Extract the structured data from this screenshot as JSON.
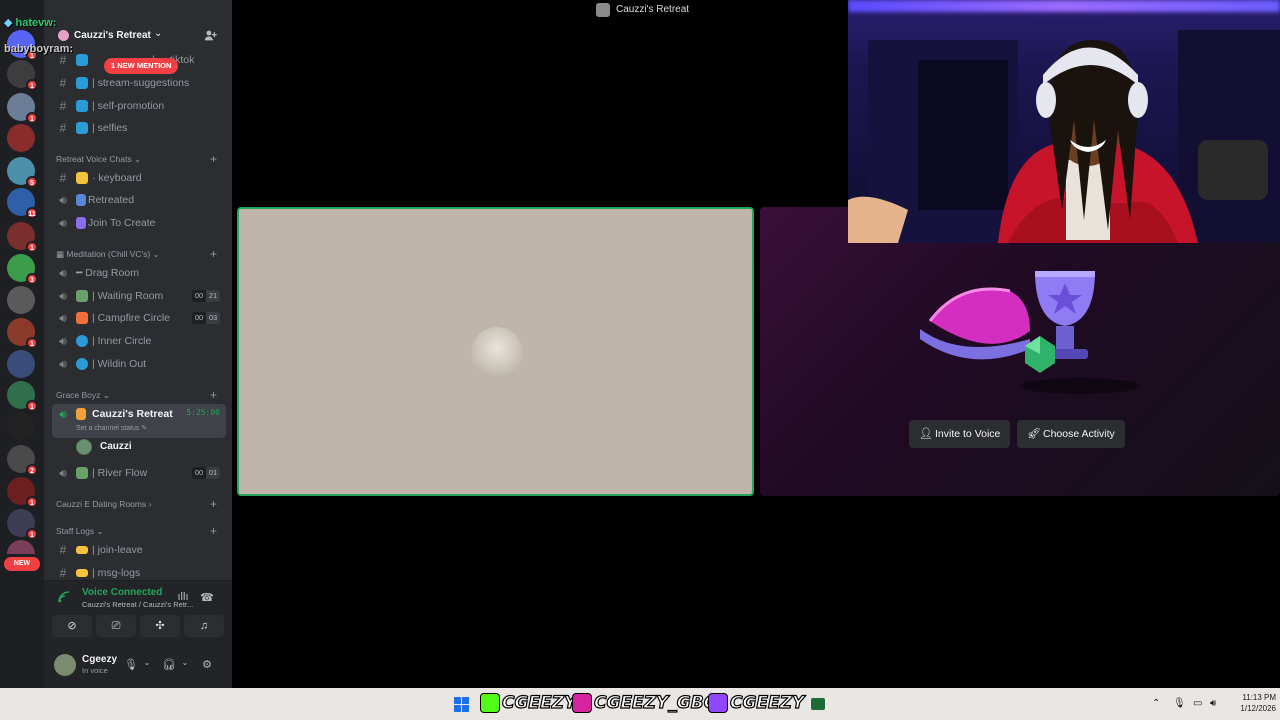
{
  "window": {
    "title": "Cauzzi's Retreat"
  },
  "stream_chat": [
    {
      "user": "hatevw:"
    },
    {
      "user": "babyboyram:"
    }
  ],
  "server": {
    "name": "Cauzzi's Retreat",
    "mention_pill": "1 NEW MENTION"
  },
  "rail": {
    "new_label": "NEW",
    "badges": [
      "1",
      "1",
      "1",
      "5",
      "11",
      "1",
      "3",
      "1",
      "1",
      "2",
      "1",
      "1",
      "1",
      "1",
      "1"
    ]
  },
  "channels_top": [
    {
      "label": "| ...-tiktok"
    },
    {
      "label": "| stream-suggestions"
    },
    {
      "label": "| self-promotion"
    },
    {
      "label": "| selfies"
    }
  ],
  "categories": {
    "retreat_voice": "Retreat Voice Chats",
    "meditation": "Meditation (Chill VC's)",
    "grace_boyz": "Grace Boyz",
    "dating": "Cauzzi E Dating Rooms",
    "staff_logs": "Staff Logs"
  },
  "retreat_voice_channels": [
    {
      "label": "· keyboard"
    },
    {
      "label": "Retreated"
    },
    {
      "label": "Join To Create"
    }
  ],
  "meditation_channels": [
    {
      "label": "Drag Room"
    },
    {
      "label": "| Waiting Room",
      "count_a": "00",
      "count_b": "21"
    },
    {
      "label": "| Campfire Circle",
      "count_a": "00",
      "count_b": "03"
    },
    {
      "label": "| Inner Circle"
    },
    {
      "label": "| Wildin Out"
    }
  ],
  "active_channel": {
    "label": "Cauzzi's Retreat",
    "timer": "5:25:00",
    "status_hint": "Set a channel status",
    "member": "Cauzzi"
  },
  "river_flow": {
    "label": "| River Flow",
    "count_a": "00",
    "count_b": "01"
  },
  "staff_channels": [
    {
      "label": "| join-leave"
    },
    {
      "label": "| msg-logs"
    }
  ],
  "voice_panel": {
    "title": "Voice Connected",
    "subtitle": "Cauzzi's Retreat / Cauzzi's Retr..."
  },
  "user": {
    "name": "Cgeezy",
    "status": "In voice"
  },
  "activity": {
    "invite_label": "Invite to Voice",
    "choose_label": "Choose Activity"
  },
  "taskbar": {
    "socials": [
      {
        "handle": "CGEEZY",
        "color": "#53fc18"
      },
      {
        "handle": "CGEEZY_GBC",
        "color": "#d6249f"
      },
      {
        "handle": "CGEEZY",
        "color": "#9146ff"
      }
    ],
    "time": "11:13 PM",
    "date": "1/12/2026"
  },
  "colors": {
    "accent_green": "#23a55a",
    "mention_red": "#f23f43",
    "sidebar_bg": "#2b2d31"
  }
}
